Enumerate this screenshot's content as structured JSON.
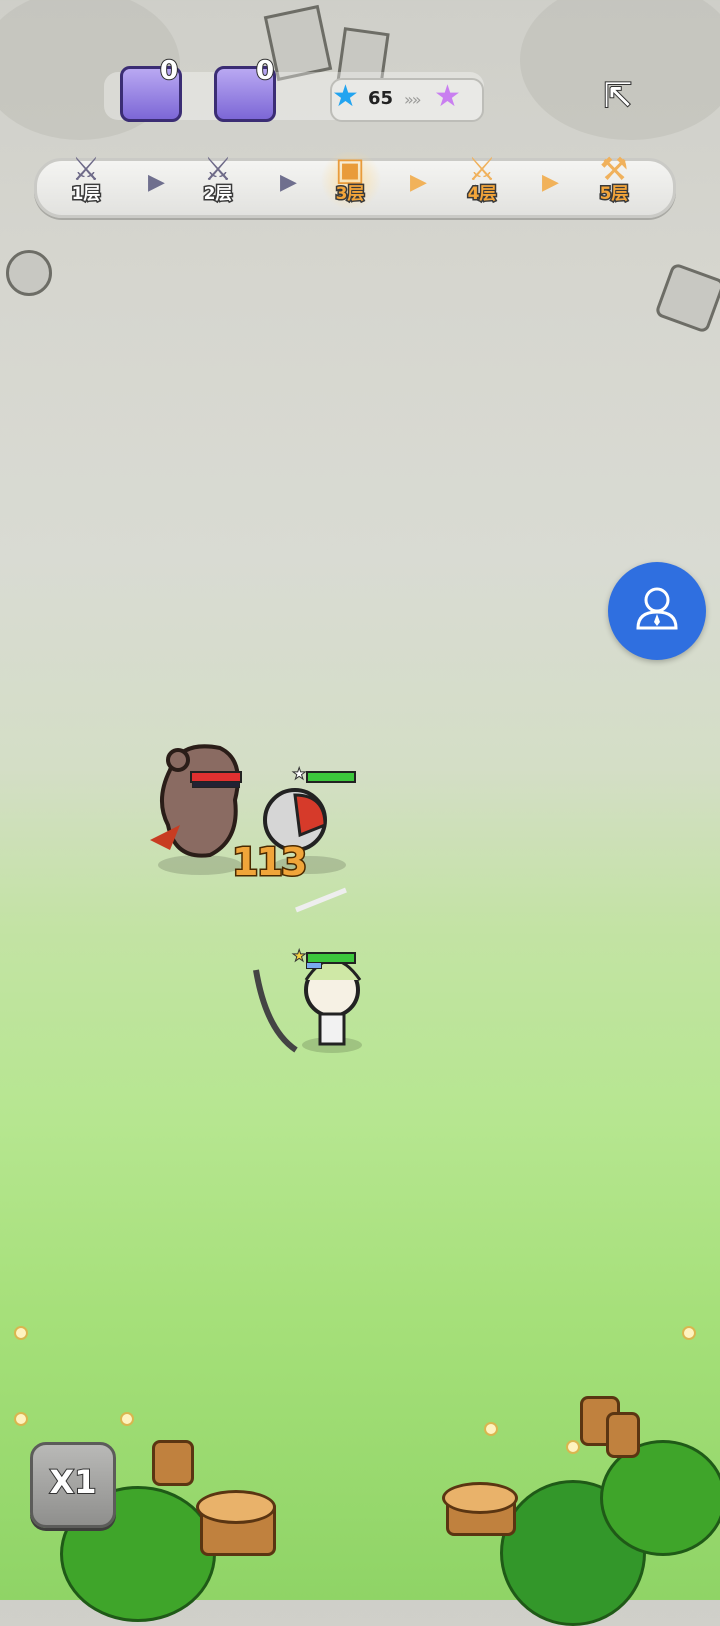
{
  "resources": {
    "anvil_count": "0",
    "chest_count": "0",
    "stars_count": "65"
  },
  "floors": [
    {
      "label": "1层",
      "state": "done",
      "icon": "crossed-swords-icon"
    },
    {
      "label": "2层",
      "state": "done",
      "icon": "crossed-swords-icon"
    },
    {
      "label": "3层",
      "state": "active",
      "icon": "treasure-chest-icon"
    },
    {
      "label": "4层",
      "state": "future",
      "icon": "crossed-swords-icon"
    },
    {
      "label": "5层",
      "state": "future",
      "icon": "hammer-icon"
    }
  ],
  "battle": {
    "damage_number": "113",
    "enemy_hp": 1.0,
    "knight_hp": 1.0,
    "archer_hp": 1.0
  },
  "controls": {
    "speed_label": "X1"
  },
  "colors": {
    "assist_button": "#2f6fe0",
    "active_floor": "#f3a53a",
    "done_floor": "#6e6a88",
    "enemy_hp": "#e03030",
    "ally_hp": "#3cc63c"
  }
}
